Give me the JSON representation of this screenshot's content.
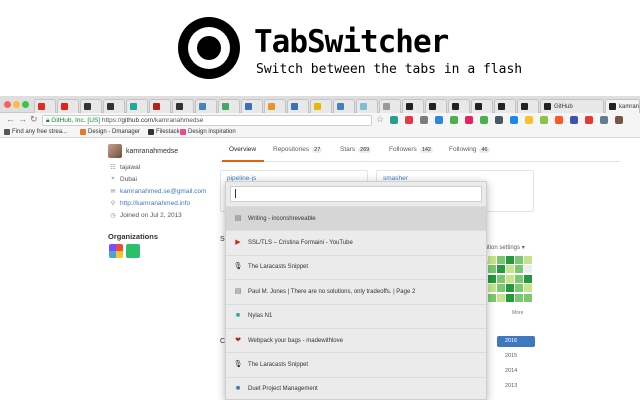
{
  "promo": {
    "title": "TabSwitcher",
    "subtitle": "Switch between the tabs in a flash"
  },
  "browser": {
    "tabs": [
      {
        "icon": "gmail-icon",
        "color": "#d93025",
        "label": ""
      },
      {
        "icon": "youtube-icon",
        "color": "#e62117",
        "label": ""
      },
      {
        "icon": "microphone-icon",
        "color": "#333333",
        "label": ""
      },
      {
        "icon": "microphone-icon",
        "color": "#333333",
        "label": ""
      },
      {
        "icon": "tab-icon",
        "color": "#20a99b",
        "label": ""
      },
      {
        "icon": "heart-icon",
        "color": "#b22222",
        "label": ""
      },
      {
        "icon": "microphone-icon",
        "color": "#333333",
        "label": ""
      },
      {
        "icon": "doc-icon",
        "color": "#4a7fc1",
        "label": ""
      },
      {
        "icon": "tab-icon",
        "color": "#4aa564",
        "label": ""
      },
      {
        "icon": "tab-icon",
        "color": "#3b6fb6",
        "label": ""
      },
      {
        "icon": "tab-icon",
        "color": "#e7952a",
        "label": ""
      },
      {
        "icon": "tab-icon",
        "color": "#3b6fb6",
        "label": ""
      },
      {
        "icon": "emoji-icon",
        "color": "#e6b800",
        "label": ""
      },
      {
        "icon": "tab-icon",
        "color": "#4a7fc1",
        "label": ""
      },
      {
        "icon": "tab-icon",
        "color": "#7fbfd6",
        "label": ""
      },
      {
        "icon": "tab-icon",
        "color": "#999999",
        "label": ""
      },
      {
        "icon": "github-icon",
        "color": "#222222",
        "label": ""
      },
      {
        "icon": "github-icon",
        "color": "#222222",
        "label": ""
      },
      {
        "icon": "github-icon",
        "color": "#222222",
        "label": ""
      },
      {
        "icon": "github-icon",
        "color": "#222222",
        "label": ""
      },
      {
        "icon": "github-icon",
        "color": "#222222",
        "label": ""
      },
      {
        "icon": "github-icon",
        "color": "#222222",
        "label": ""
      },
      {
        "icon": "github-icon",
        "color": "#222222",
        "label": "GitHub"
      },
      {
        "icon": "github-icon",
        "color": "#222222",
        "label": "kamranahmedse (K..."
      },
      {
        "icon": "doc-icon",
        "color": "#999999",
        "label": "kamran"
      }
    ],
    "url": {
      "secure_label": "GitHub, Inc. [US]",
      "protocol": "https://",
      "host": "github.com",
      "path": "/kamranahmedse"
    },
    "bookmarks": [
      {
        "icon": "bookmark-icon",
        "color": "#555555",
        "label": "Find any free strea..."
      },
      {
        "icon": "brave-icon",
        "color": "#e8772e",
        "label": "Design - Dmanager"
      },
      {
        "icon": "filestack-icon",
        "color": "#333333",
        "label": "Filestack"
      },
      {
        "icon": "dribbble-icon",
        "color": "#ea4c89",
        "label": "Design inspiration"
      }
    ],
    "extensions": [
      "#2a9d8f",
      "#e63946",
      "#7b7b7b",
      "#2e86de",
      "#4caf50",
      "#e91e63",
      "#4caf50",
      "#455a64",
      "#1e88e5",
      "#fbc02d",
      "#8bc34a",
      "#ff5722",
      "#3f51b5",
      "#e53935",
      "#607d8b",
      "#795548"
    ]
  },
  "profile": {
    "username": "kamranahmedse",
    "rows": [
      {
        "icon": "people-icon",
        "text": "tajawal",
        "is_link": false
      },
      {
        "icon": "location-icon",
        "text": "Dubai",
        "is_link": false
      },
      {
        "icon": "mail-icon",
        "text": "kamranahmed.se@gmail.com",
        "is_link": true
      },
      {
        "icon": "link-icon",
        "text": "http://kamranahmed.info",
        "is_link": true
      },
      {
        "icon": "clock-icon",
        "text": "Joined on Jul 2, 2013",
        "is_link": false
      }
    ],
    "organizations_title": "Organizations"
  },
  "nav": {
    "tabs": [
      {
        "label": "Overview",
        "count": ""
      },
      {
        "label": "Repositories",
        "count": "27"
      },
      {
        "label": "Stars",
        "count": "269"
      },
      {
        "label": "Followers",
        "count": "142"
      },
      {
        "label": "Following",
        "count": "46"
      }
    ]
  },
  "cards": [
    {
      "title": "pipeline-js"
    },
    {
      "title": "smasher"
    }
  ],
  "contrib": {
    "settings_label": "ribution settings ▾",
    "less_label": "Sep",
    "more_label": "More",
    "years": [
      "2016",
      "2015",
      "2014",
      "2013"
    ]
  },
  "switcher": {
    "query": "",
    "items": [
      {
        "icon": "doc-icon",
        "color": "#666666",
        "title": "Writing - inconshreveable"
      },
      {
        "icon": "youtube-icon",
        "color": "#e62117",
        "title": "SSL/TLS – Cristina Formaini - YouTube"
      },
      {
        "icon": "microphone-icon",
        "color": "#222222",
        "title": "The Laracasts Snippet"
      },
      {
        "icon": "doc-icon",
        "color": "#666666",
        "title": "Paul M. Jones | There are no solutions, only tradeoffs. | Page 2"
      },
      {
        "icon": "nylas-icon",
        "color": "#20a99b",
        "title": "Nylas N1"
      },
      {
        "icon": "heart-icon",
        "color": "#b22222",
        "title": "Webpack your bags - madewithlove"
      },
      {
        "icon": "microphone-icon",
        "color": "#222222",
        "title": "The Laracasts Snippet"
      },
      {
        "icon": "duet-icon",
        "color": "#3b6fb6",
        "title": "Duet Project Management"
      }
    ]
  }
}
